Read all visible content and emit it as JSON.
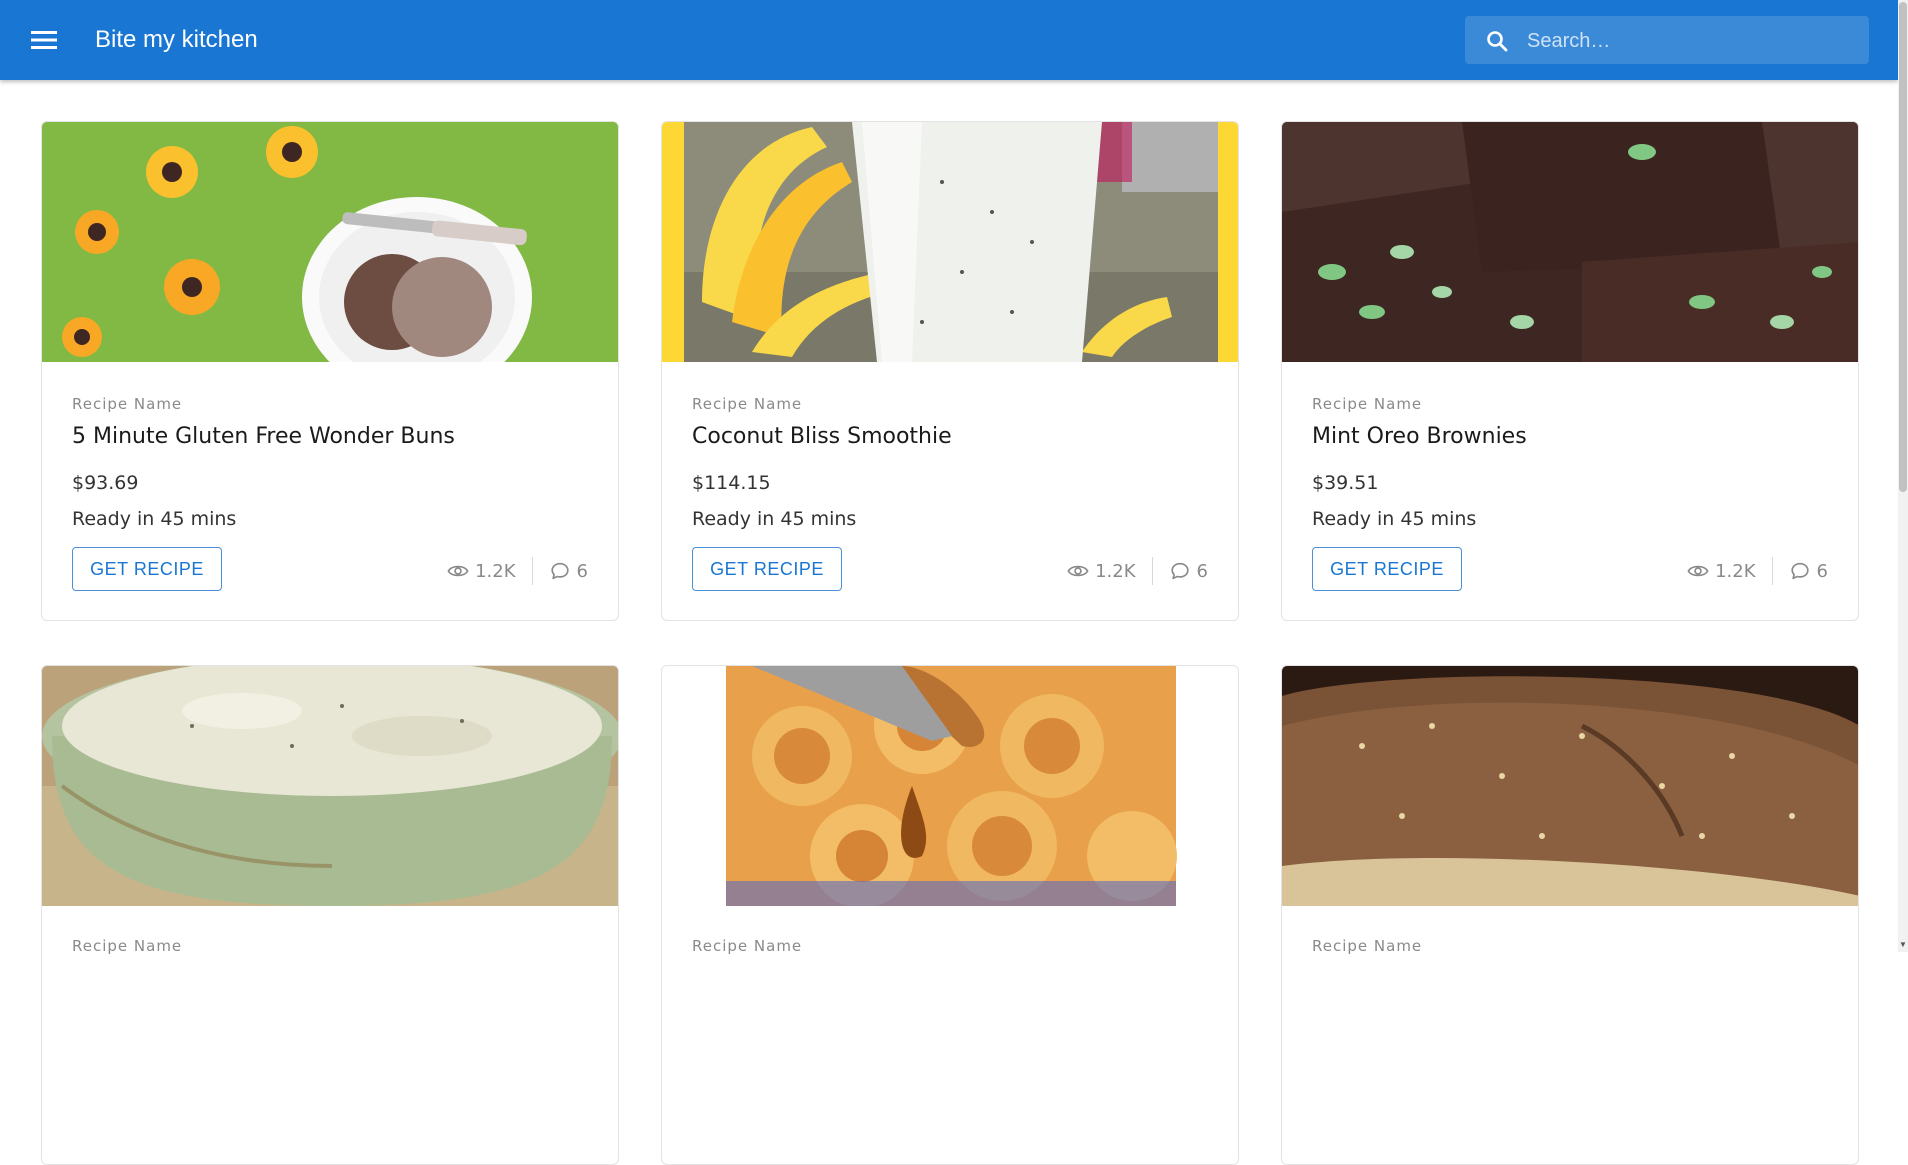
{
  "app": {
    "title": "Bite my kitchen",
    "accent": "#1976d2"
  },
  "search": {
    "placeholder": "Search…",
    "value": ""
  },
  "cards": [
    {
      "overline": "Recipe Name",
      "name": "5 Minute Gluten Free Wonder Buns",
      "price": "$93.69",
      "ready": "Ready in 45 mins",
      "button": "GET RECIPE",
      "views": "1.2K",
      "comments": "6"
    },
    {
      "overline": "Recipe Name",
      "name": "Coconut Bliss Smoothie",
      "price": "$114.15",
      "ready": "Ready in 45 mins",
      "button": "GET RECIPE",
      "views": "1.2K",
      "comments": "6"
    },
    {
      "overline": "Recipe Name",
      "name": "Mint Oreo Brownies",
      "price": "$39.51",
      "ready": "Ready in 45 mins",
      "button": "GET RECIPE",
      "views": "1.2K",
      "comments": "6"
    },
    {
      "overline": "Recipe Name"
    },
    {
      "overline": "Recipe Name"
    },
    {
      "overline": "Recipe Name"
    }
  ]
}
